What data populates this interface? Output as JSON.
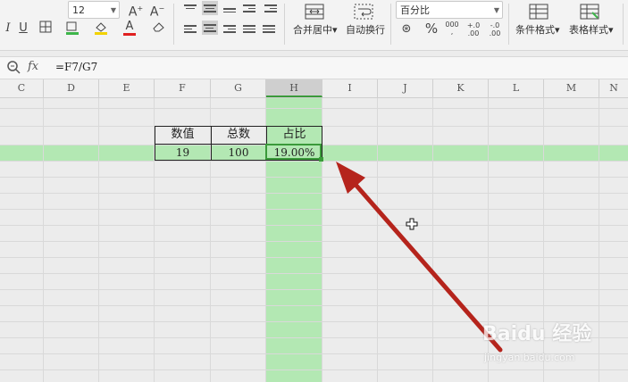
{
  "toolbar": {
    "font_size": "12",
    "grow_font_icon": "A⁺",
    "shrink_font_icon": "A⁻",
    "italic": "I",
    "underline": "U",
    "font_color_letter": "A",
    "merge_center_label": "合并居中▾",
    "wrap_text_label": "自动换行",
    "number_format": "百分比",
    "percent_symbol": "%",
    "thousands_symbol": "000",
    "increase_decimal": "+.0\n.00",
    "decrease_decimal": "-.0\n.00",
    "conditional_format_label": "条件格式▾",
    "table_style_label": "表格样式▾"
  },
  "formula_bar": {
    "fx_label": "fx",
    "formula": "=F7/G7"
  },
  "columns": [
    "C",
    "D",
    "E",
    "F",
    "G",
    "H",
    "I",
    "J",
    "K",
    "L",
    "M",
    "N"
  ],
  "table": {
    "headers": [
      "数值",
      "总数",
      "占比"
    ],
    "row": [
      "19",
      "100",
      "19.00%"
    ]
  },
  "annotation": {
    "arrow_color": "#b5241c",
    "highlight_color": "#b3e8b3"
  },
  "watermark": {
    "text": "Baidu 经验",
    "url": "jingyan.baidu.com"
  }
}
